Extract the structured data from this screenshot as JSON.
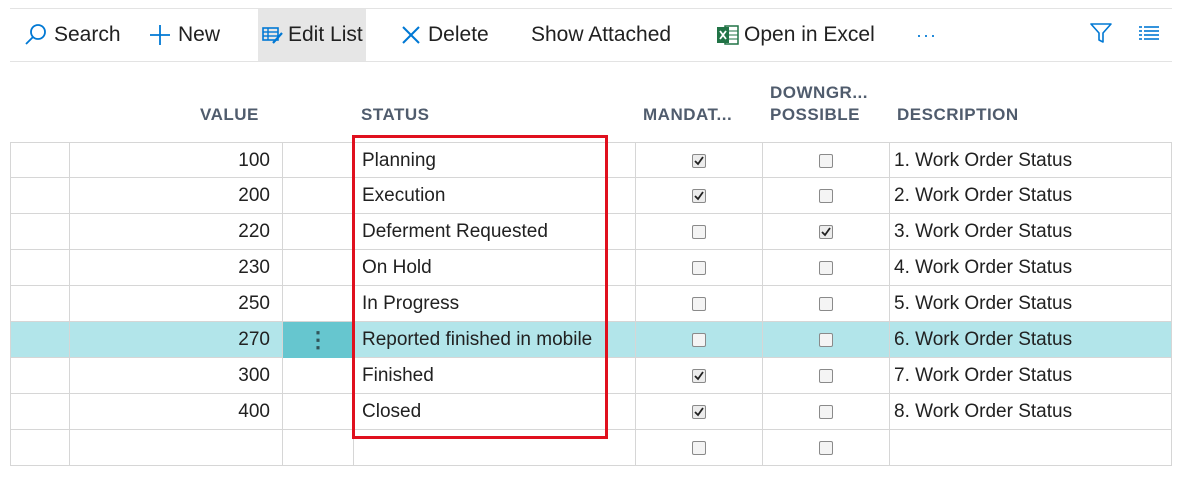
{
  "toolbar": {
    "search_label": "Search",
    "new_label": "New",
    "edit_list_label": "Edit List",
    "delete_label": "Delete",
    "show_attached_label": "Show Attached",
    "open_excel_label": "Open in Excel",
    "more_label": "···",
    "accent_color": "#0078d4",
    "excel_color": "#217346"
  },
  "columns": {
    "value": "VALUE",
    "status": "STATUS",
    "mandatory": "MANDAT...",
    "downgrade_line1": "DOWNGR...",
    "downgrade_line2": "POSSIBLE",
    "description": "DESCRIPTION"
  },
  "rows": [
    {
      "value": "100",
      "status": "Planning",
      "mandatory": true,
      "downgrade": false,
      "description": "1. Work Order Status"
    },
    {
      "value": "200",
      "status": "Execution",
      "mandatory": true,
      "downgrade": false,
      "description": "2. Work Order Status"
    },
    {
      "value": "220",
      "status": "Deferment Requested",
      "mandatory": false,
      "downgrade": true,
      "description": "3. Work Order Status"
    },
    {
      "value": "230",
      "status": "On Hold",
      "mandatory": false,
      "downgrade": false,
      "description": "4. Work Order Status"
    },
    {
      "value": "250",
      "status": "In Progress",
      "mandatory": false,
      "downgrade": false,
      "description": "5. Work Order Status"
    },
    {
      "value": "270",
      "status": "Reported finished in mobile",
      "mandatory": false,
      "downgrade": false,
      "description": "6. Work Order Status",
      "selected": true
    },
    {
      "value": "300",
      "status": "Finished",
      "mandatory": true,
      "downgrade": false,
      "description": "7. Work Order Status"
    },
    {
      "value": "400",
      "status": "Closed",
      "mandatory": true,
      "downgrade": false,
      "description": "8. Work Order Status"
    },
    {
      "value": "",
      "status": "",
      "mandatory": false,
      "downgrade": false,
      "description": ""
    }
  ],
  "row_menu_icon": "⋮",
  "highlight_color": "#e0101e",
  "selected_row_color": "#b2e5ea"
}
